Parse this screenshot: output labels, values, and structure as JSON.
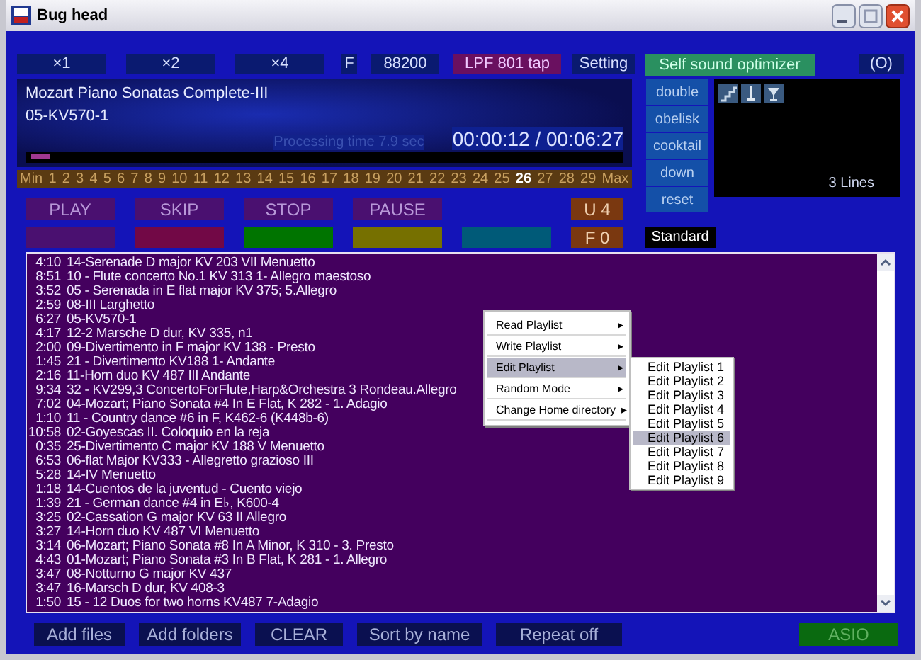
{
  "window": {
    "title": "Bug head"
  },
  "toolbar": [
    {
      "label": "×1",
      "kind": "plain"
    },
    {
      "label": "×2",
      "kind": "plain"
    },
    {
      "label": "×4",
      "kind": "plain"
    },
    {
      "label": "F",
      "kind": "plain"
    },
    {
      "label": "88200",
      "kind": "plain"
    },
    {
      "label": "LPF 801 tap",
      "kind": "filter"
    },
    {
      "label": "Setting",
      "kind": "plain"
    },
    {
      "label": "Self sound optimizer",
      "kind": "optimizer"
    },
    {
      "label": "(O)",
      "kind": "plain"
    }
  ],
  "display": {
    "album": "Mozart Piano Sonatas Complete-III",
    "track": "05-KV570-1",
    "processing": "Processing time  7.9 sec",
    "time": "00:00:12 / 00:06:27",
    "progress": {
      "level": 0.03
    }
  },
  "effects": [
    "double",
    "obelisk",
    "cooktail",
    "down",
    "reset"
  ],
  "lines_panel": {
    "label": "3 Lines"
  },
  "track_numbers": [
    {
      "label": "Min",
      "selected": false
    },
    {
      "label": "1",
      "selected": false
    },
    {
      "label": "2",
      "selected": false
    },
    {
      "label": "3",
      "selected": false
    },
    {
      "label": "4",
      "selected": false
    },
    {
      "label": "5",
      "selected": false
    },
    {
      "label": "6",
      "selected": false
    },
    {
      "label": "7",
      "selected": false
    },
    {
      "label": "8",
      "selected": false
    },
    {
      "label": "9",
      "selected": false
    },
    {
      "label": "10",
      "selected": false
    },
    {
      "label": "11",
      "selected": false
    },
    {
      "label": "12",
      "selected": false
    },
    {
      "label": "13",
      "selected": false
    },
    {
      "label": "14",
      "selected": false
    },
    {
      "label": "15",
      "selected": false
    },
    {
      "label": "16",
      "selected": false
    },
    {
      "label": "17",
      "selected": false
    },
    {
      "label": "18",
      "selected": false
    },
    {
      "label": "19",
      "selected": false
    },
    {
      "label": "20",
      "selected": false
    },
    {
      "label": "21",
      "selected": false
    },
    {
      "label": "22",
      "selected": false
    },
    {
      "label": "23",
      "selected": false
    },
    {
      "label": "24",
      "selected": false
    },
    {
      "label": "25",
      "selected": false
    },
    {
      "label": "26",
      "selected": true
    },
    {
      "label": "27",
      "selected": false
    },
    {
      "label": "28",
      "selected": false
    },
    {
      "label": "29",
      "selected": false
    },
    {
      "label": "Max",
      "selected": false
    }
  ],
  "transport": [
    "PLAY",
    "SKIP",
    "STOP",
    "PAUSE"
  ],
  "counters": [
    "U 4",
    "F 0"
  ],
  "swatches": [
    {
      "color": "#4a1070"
    },
    {
      "color": "#720846"
    },
    {
      "color": "#007400"
    },
    {
      "color": "#767000"
    },
    {
      "color": "#005a78"
    }
  ],
  "mode": "Standard",
  "playlist": [
    {
      "time": "4:10",
      "title": "14-Serenade D major KV 203 VII Menuetto"
    },
    {
      "time": "8:51",
      "title": "10 - Flute concerto No.1 KV 313  1- Allegro maestoso"
    },
    {
      "time": "3:52",
      "title": "05 - Serenada in E flat major KV 375; 5.Allegro"
    },
    {
      "time": "2:59",
      "title": "08-III Larghetto"
    },
    {
      "time": "6:27",
      "title": "05-KV570-1"
    },
    {
      "time": "4:17",
      "title": "12-2 Marsche D dur, KV 335, n1"
    },
    {
      "time": "2:00",
      "title": "09-Divertimento in F major KV 138 - Presto"
    },
    {
      "time": "1:45",
      "title": "21 - Divertimento KV188 1- Andante"
    },
    {
      "time": "2:16",
      "title": "11-Horn duo KV 487 III Andante"
    },
    {
      "time": "9:34",
      "title": "32 - KV299,3 ConcertoForFlute,Harp&Orchestra 3 Rondeau.Allegro"
    },
    {
      "time": "7:02",
      "title": "04-Mozart; Piano Sonata #4 In E Flat, K 282 - 1. Adagio"
    },
    {
      "time": "1:10",
      "title": "11 - Country dance #6 in F, K462-6 (K448b-6)"
    },
    {
      "time": "10:58",
      "title": "02-Goyescas II. Coloquio en la reja"
    },
    {
      "time": "0:35",
      "title": "25-Divertimento C major KV 188 V Menuetto"
    },
    {
      "time": "6:53",
      "title": "06-flat Major KV333 - Allegretto grazioso III"
    },
    {
      "time": "5:28",
      "title": "14-IV Menuetto"
    },
    {
      "time": "1:18",
      "title": "14-Cuentos de la juventud - Cuento viejo"
    },
    {
      "time": "1:39",
      "title": "21 - German dance #4 in E♭, K600-4"
    },
    {
      "time": "3:25",
      "title": "02-Cassation G major KV 63 II Allegro"
    },
    {
      "time": "3:27",
      "title": "14-Horn duo KV 487 VI Menuetto"
    },
    {
      "time": "3:14",
      "title": "06-Mozart; Piano Sonata #8 In A Minor, K 310 - 3. Presto"
    },
    {
      "time": "4:43",
      "title": "01-Mozart; Piano Sonata #3 In B Flat, K 281 - 1. Allegro"
    },
    {
      "time": "3:47",
      "title": "08-Notturno G major KV 437"
    },
    {
      "time": "3:47",
      "title": "16-Marsch D dur, KV 408-3"
    },
    {
      "time": "1:50",
      "title": "15 - 12 Duos for two horns KV487 7-Adagio"
    }
  ],
  "context_menu": {
    "items": [
      {
        "label": "Read Playlist",
        "selected": false
      },
      {
        "label": "Write Playlist",
        "selected": false
      },
      {
        "label": "Edit Playlist",
        "selected": true
      },
      {
        "label": "Random Mode",
        "selected": false
      },
      {
        "label": "Change Home directory",
        "selected": false
      }
    ],
    "arrow": "▸",
    "submenu": [
      {
        "label": "Edit Playlist 1",
        "selected": false
      },
      {
        "label": "Edit Playlist 2",
        "selected": false
      },
      {
        "label": "Edit Playlist 3",
        "selected": false
      },
      {
        "label": "Edit Playlist 4",
        "selected": false
      },
      {
        "label": "Edit Playlist 5",
        "selected": false
      },
      {
        "label": "Edit Playlist 6",
        "selected": true
      },
      {
        "label": "Edit Playlist 7",
        "selected": false
      },
      {
        "label": "Edit Playlist 8",
        "selected": false
      },
      {
        "label": "Edit Playlist 9",
        "selected": false
      }
    ]
  },
  "bottom_buttons": [
    "Add files",
    "Add folders",
    "CLEAR",
    "Sort by name",
    "Repeat off"
  ],
  "output": "ASIO"
}
